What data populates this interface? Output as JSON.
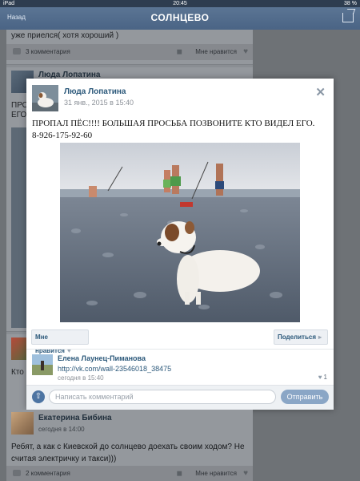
{
  "statusbar": {
    "device": "iPad",
    "time": "20:45",
    "battery": "38 %"
  },
  "navbar": {
    "back_label": "Назад",
    "title": "СОЛНЦЕВО"
  },
  "background_feed": {
    "card1": {
      "text": "уже приелся( хотя хороший )",
      "comments_label": "3 комментария",
      "likes_label": "Мне нравится"
    },
    "card2": {
      "partial_name": "Люда Лопатина",
      "partial_text_1": "ПРО",
      "partial_text_2": "ЕГО."
    },
    "card3": {
      "partial_text": "Кто"
    },
    "card4": {
      "name": "Екатерина Бибина",
      "time": "сегодня в 14:00",
      "text": "Ребят, а как с Киевской до солнцево доехать своим ходом? Не считая электричку и такси)))",
      "comments_label": "2 комментария",
      "likes_label": "Мне нравится"
    }
  },
  "modal": {
    "author": "Люда Лопатина",
    "date": "31 янв., 2015 в 15:40",
    "text_line1": "ПРОПАЛ ПЁС!!!! БОЛЬШАЯ ПРОСЬБА ПОЗВОНИТЕ КТО ВИДЕЛ ЕГО.",
    "text_line2": "8-926-175-92-60",
    "like_label": "Мне нравится",
    "share_label": "Поделиться",
    "comment": {
      "author": "Елена Лаунец-Пиманова",
      "link": "http://vk.com/wall-23546018_38475",
      "time": "сегодня в 15:40",
      "likes": "1"
    },
    "composer": {
      "placeholder": "Написать комментарий",
      "send_label": "Отправить"
    }
  },
  "colors": {
    "accent": "#2b587a",
    "navbar": "#4a6485",
    "send_button": "#8aa6c6"
  },
  "icons": {
    "close": "close-icon",
    "heart": "heart-icon",
    "share": "megaphone-icon",
    "attach": "attach-icon"
  }
}
